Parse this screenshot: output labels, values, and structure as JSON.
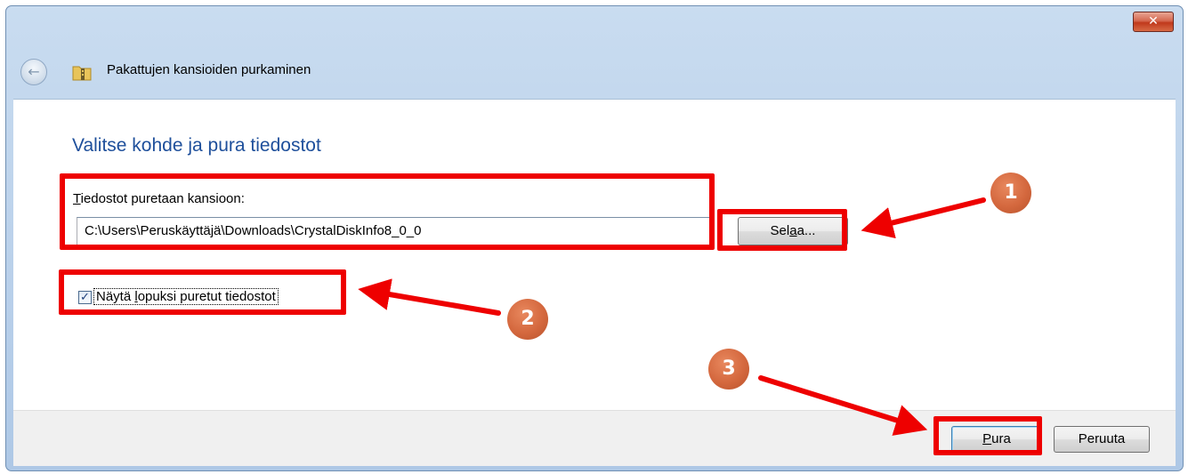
{
  "window": {
    "title": "Pakattujen kansioiden purkaminen",
    "close_glyph": "✕"
  },
  "main": {
    "heading": "Valitse kohde ja pura tiedostot",
    "folder_label_accel": "T",
    "folder_label_rest": "iedostot puretaan kansioon:",
    "folder_path": "C:\\Users\\Peruskäyttäjä\\Downloads\\CrystalDiskInfo8_0_0",
    "browse": {
      "pre": "Sel",
      "accel": "a",
      "post": "a..."
    },
    "show_files": {
      "checked": true,
      "check_glyph": "✓",
      "label_pre": "Näytä ",
      "label_accel": "l",
      "label_post": "opuksi puretut tiedostot"
    }
  },
  "footer": {
    "extract": {
      "accel": "P",
      "rest": "ura"
    },
    "cancel_label": "Peruuta"
  },
  "annotations": [
    {
      "number": "1",
      "target": "Selaa... button"
    },
    {
      "number": "2",
      "target": "Näytä lopuksi puretut tiedostot checkbox"
    },
    {
      "number": "3",
      "target": "Pura button"
    }
  ],
  "colors": {
    "heading": "#1e4f9b",
    "highlight": "#ee0000",
    "marker": "#d4683e",
    "footer": "#f0f0f0"
  },
  "icons": [
    "back-arrow-icon",
    "zipped-folder-icon",
    "close-icon",
    "checkmark-icon"
  ]
}
